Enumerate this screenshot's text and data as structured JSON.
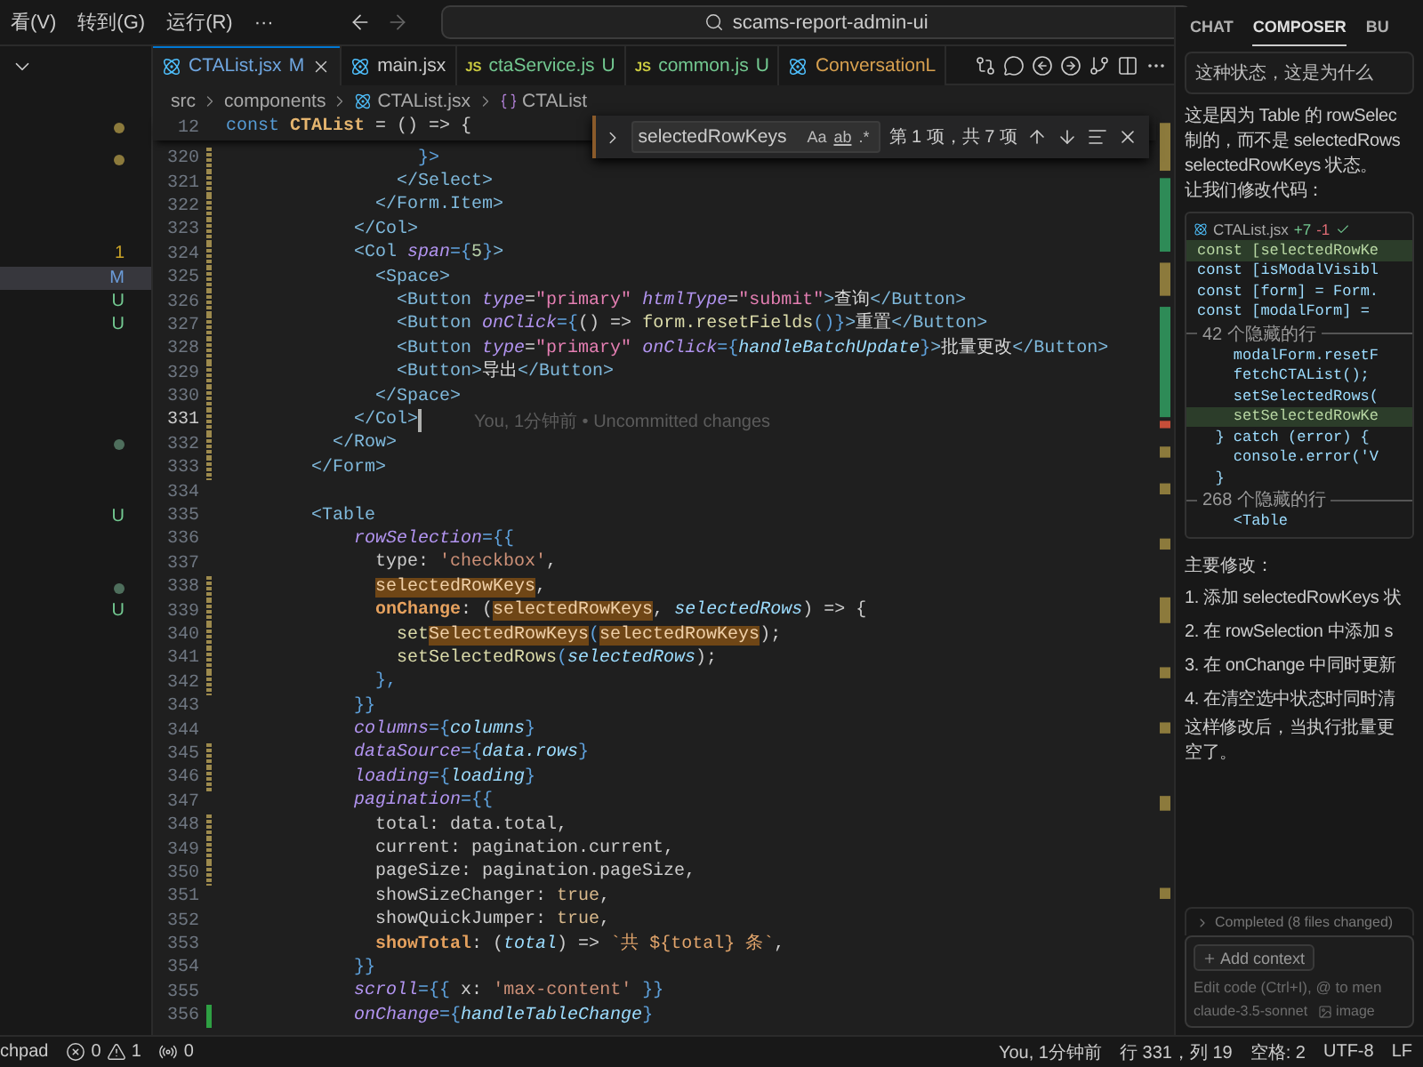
{
  "menu": [
    "看(V)",
    "转到(G)",
    "运行(R)",
    "···"
  ],
  "command_center": {
    "text": "scams-report-admin-ui"
  },
  "tabs": [
    {
      "label": "CTAList.jsx",
      "badge": "M",
      "kind": "react",
      "color": "#6fa6e0",
      "selected": true,
      "close_button": true
    },
    {
      "label": "main.jsx",
      "kind": "react",
      "color": "#cccccc",
      "selected": false,
      "close_button": false
    },
    {
      "label": "ctaService.js",
      "badge": "U",
      "kind": "js",
      "icon_text": "JS",
      "color": "#73c991",
      "selected": false,
      "close_button": false
    },
    {
      "label": "common.js",
      "badge": "U",
      "kind": "js",
      "icon_text": "JS",
      "color": "#73c991",
      "selected": false,
      "close_button": false
    },
    {
      "label": "ConversationL",
      "kind": "react",
      "color": "#d7a04f",
      "selected": false,
      "close_button": false
    }
  ],
  "breadcrumb": [
    {
      "label": "src",
      "kind": "folder"
    },
    {
      "label": "components",
      "kind": "folder"
    },
    {
      "label": "CTAList.jsx",
      "kind": "file"
    },
    {
      "label": "CTAList",
      "kind": "symbol"
    }
  ],
  "find": {
    "query": "selectedRowKeys",
    "options": [
      {
        "label": "Aa",
        "kind": "case"
      },
      {
        "label": "ab",
        "kind": "word"
      },
      {
        "label": ".*",
        "kind": "regex"
      }
    ],
    "result": "第 1 项，共 7 项"
  },
  "explorer": {
    "items": [
      {
        "kind": "dot",
        "color": "#8c7a3c",
        "selected": false
      },
      {
        "kind": "dot",
        "color": "#8c7a3c",
        "selected": false
      },
      {
        "kind": "blank",
        "selected": false
      },
      {
        "kind": "blank",
        "selected": false
      },
      {
        "kind": "blank",
        "selected": false
      },
      {
        "kind": "letter",
        "text": "1",
        "color": "#c9a227",
        "selected": false
      },
      {
        "kind": "letter",
        "text": "M",
        "color": "#6b9bd8",
        "selected": true
      },
      {
        "kind": "letter",
        "text": "U",
        "color": "#73c991",
        "selected": false
      },
      {
        "kind": "letter",
        "text": "U",
        "color": "#73c991",
        "selected": false
      },
      {
        "kind": "blank",
        "selected": false
      },
      {
        "kind": "blank",
        "selected": false
      },
      {
        "kind": "blank",
        "selected": false
      },
      {
        "kind": "blank",
        "selected": false
      },
      {
        "kind": "dot",
        "color": "#4e6e5c",
        "selected": false
      },
      {
        "kind": "blank",
        "selected": false
      },
      {
        "kind": "blank",
        "selected": false
      },
      {
        "kind": "letter",
        "text": "U",
        "color": "#73c991",
        "selected": false
      },
      {
        "kind": "blank",
        "selected": false
      },
      {
        "kind": "blank",
        "selected": false
      },
      {
        "kind": "dot",
        "color": "#4e6e5c",
        "selected": false
      },
      {
        "kind": "letter",
        "text": "U",
        "color": "#73c991",
        "selected": false
      }
    ]
  },
  "code": {
    "sticky": {
      "n": "12",
      "tokens": [
        {
          "text": "const ",
          "kind": "kw"
        },
        {
          "text": "CTAList",
          "kind": "name"
        },
        {
          "text": " = () => {",
          "kind": "p"
        }
      ]
    },
    "lines": [
      {
        "n": "320",
        "current": false,
        "kind": "modified",
        "tokens": [
          {
            "text": "                  }>",
            "kind": "brace"
          }
        ]
      },
      {
        "n": "321",
        "current": false,
        "kind": "modified",
        "tokens": [
          {
            "text": "                </Select>",
            "kind": "tag"
          }
        ]
      },
      {
        "n": "322",
        "current": false,
        "kind": "modified",
        "tokens": [
          {
            "text": "              </Form.Item>",
            "kind": "tag"
          }
        ]
      },
      {
        "n": "323",
        "current": false,
        "kind": "modified",
        "tokens": [
          {
            "text": "            </Col>",
            "kind": "tag"
          }
        ]
      },
      {
        "n": "324",
        "current": false,
        "kind": "modified",
        "tokens": [
          {
            "text": "            <Col ",
            "kind": "tag"
          },
          {
            "text": "span",
            "kind": "attr"
          },
          {
            "text": "={",
            "kind": "brace"
          },
          {
            "text": "5",
            "kind": "num"
          },
          {
            "text": "}",
            "kind": "brace"
          },
          {
            "text": ">",
            "kind": "tag"
          }
        ]
      },
      {
        "n": "325",
        "current": false,
        "kind": "modified",
        "tokens": [
          {
            "text": "              <Space>",
            "kind": "tag"
          }
        ]
      },
      {
        "n": "326",
        "current": false,
        "kind": "modified",
        "tokens": [
          {
            "text": "                <Button ",
            "kind": "tag"
          },
          {
            "text": "type",
            "kind": "attr"
          },
          {
            "text": "=",
            "kind": "p"
          },
          {
            "text": "\"primary\"",
            "kind": "str"
          },
          {
            "text": " htmlType",
            "kind": "attr"
          },
          {
            "text": "=",
            "kind": "p"
          },
          {
            "text": "\"submit\"",
            "kind": "str"
          },
          {
            "text": ">",
            "kind": "tag"
          },
          {
            "text": "查询",
            "kind": "text"
          },
          {
            "text": "</Button>",
            "kind": "tag"
          }
        ]
      },
      {
        "n": "327",
        "current": false,
        "kind": "modified",
        "tokens": [
          {
            "text": "                <Button ",
            "kind": "tag"
          },
          {
            "text": "onClick",
            "kind": "attr"
          },
          {
            "text": "={",
            "kind": "brace"
          },
          {
            "text": "() => ",
            "kind": "p"
          },
          {
            "text": "form.resetFields",
            "kind": "fn"
          },
          {
            "text": "()",
            "kind": "brace"
          },
          {
            "text": "}",
            "kind": "brace"
          },
          {
            "text": ">",
            "kind": "tag"
          },
          {
            "text": "重置",
            "kind": "text"
          },
          {
            "text": "</Button>",
            "kind": "tag"
          }
        ]
      },
      {
        "n": "328",
        "current": false,
        "kind": "modified",
        "tokens": [
          {
            "text": "                <Button ",
            "kind": "tag"
          },
          {
            "text": "type",
            "kind": "attr"
          },
          {
            "text": "=",
            "kind": "p"
          },
          {
            "text": "\"primary\"",
            "kind": "str"
          },
          {
            "text": " onClick",
            "kind": "attr"
          },
          {
            "text": "={",
            "kind": "brace"
          },
          {
            "text": "handleBatchUpdate",
            "kind": "param"
          },
          {
            "text": "}",
            "kind": "brace"
          },
          {
            "text": ">",
            "kind": "tag"
          },
          {
            "text": "批量更改",
            "kind": "text"
          },
          {
            "text": "</Button>",
            "kind": "tag"
          }
        ]
      },
      {
        "n": "329",
        "current": false,
        "kind": "modified",
        "tokens": [
          {
            "text": "                <Button>",
            "kind": "tag"
          },
          {
            "text": "导出",
            "kind": "text"
          },
          {
            "text": "</Button>",
            "kind": "tag"
          }
        ]
      },
      {
        "n": "330",
        "current": false,
        "kind": "modified",
        "tokens": [
          {
            "text": "              </Space>",
            "kind": "tag"
          }
        ]
      },
      {
        "n": "331",
        "current": true,
        "kind": "modified",
        "tokens": [
          {
            "text": "            </Col>",
            "kind": "tag"
          }
        ],
        "annotation": "You, 1分钟前 • Uncommitted changes"
      },
      {
        "n": "332",
        "current": false,
        "kind": "modified",
        "tokens": [
          {
            "text": "          </Row>",
            "kind": "tag"
          }
        ]
      },
      {
        "n": "333",
        "current": false,
        "kind": "modified",
        "tokens": [
          {
            "text": "        </Form>",
            "kind": "tag"
          }
        ]
      },
      {
        "n": "334",
        "current": false,
        "kind": "plain"
      },
      {
        "n": "335",
        "current": false,
        "kind": "plain",
        "tokens": [
          {
            "text": "        <Table",
            "kind": "tag"
          }
        ]
      },
      {
        "n": "336",
        "current": false,
        "kind": "plain",
        "tokens": [
          {
            "text": "            rowSelection",
            "kind": "attr"
          },
          {
            "text": "={{",
            "kind": "brace"
          }
        ]
      },
      {
        "n": "337",
        "current": false,
        "kind": "plain",
        "tokens": [
          {
            "text": "              type",
            "kind": "prop"
          },
          {
            "text": ": ",
            "kind": "p"
          },
          {
            "text": "'checkbox'",
            "kind": "sq"
          },
          {
            "text": ",",
            "kind": "p"
          }
        ]
      },
      {
        "n": "338",
        "current": false,
        "kind": "modified",
        "tokens": [
          {
            "text": "              selectedRowKeys",
            "kind": "match"
          },
          {
            "text": ",",
            "kind": "p"
          }
        ]
      },
      {
        "n": "339",
        "current": false,
        "kind": "modified",
        "tokens": [
          {
            "text": "              onChange",
            "kind": "key"
          },
          {
            "text": ": (",
            "kind": "p"
          },
          {
            "text": "selectedRowKeys",
            "kind": "match"
          },
          {
            "text": ", ",
            "kind": "p"
          },
          {
            "text": "selectedRows",
            "kind": "param"
          },
          {
            "text": ") => {",
            "kind": "p"
          }
        ]
      },
      {
        "n": "340",
        "current": false,
        "kind": "modified",
        "tokens": [
          {
            "text": "                set",
            "kind": "fn"
          },
          {
            "text": "SelectedRowKeys",
            "kind": "match"
          },
          {
            "text": "(",
            "kind": "brace"
          },
          {
            "text": "selectedRowKeys",
            "kind": "match"
          },
          {
            "text": ");",
            "kind": "p"
          }
        ]
      },
      {
        "n": "341",
        "current": false,
        "kind": "modified",
        "tokens": [
          {
            "text": "                setSelectedRows",
            "kind": "fn"
          },
          {
            "text": "(",
            "kind": "brace"
          },
          {
            "text": "selectedRows",
            "kind": "param"
          },
          {
            "text": ");",
            "kind": "p"
          }
        ]
      },
      {
        "n": "342",
        "current": false,
        "kind": "modified",
        "tokens": [
          {
            "text": "              },",
            "kind": "brace"
          }
        ]
      },
      {
        "n": "343",
        "current": false,
        "kind": "plain",
        "tokens": [
          {
            "text": "            }}",
            "kind": "brace"
          }
        ]
      },
      {
        "n": "344",
        "current": false,
        "kind": "plain",
        "tokens": [
          {
            "text": "            columns",
            "kind": "attr"
          },
          {
            "text": "={",
            "kind": "brace"
          },
          {
            "text": "columns",
            "kind": "param"
          },
          {
            "text": "}",
            "kind": "brace"
          }
        ]
      },
      {
        "n": "345",
        "current": false,
        "kind": "modified",
        "tokens": [
          {
            "text": "            dataSource",
            "kind": "attr"
          },
          {
            "text": "={",
            "kind": "brace"
          },
          {
            "text": "data.rows",
            "kind": "param"
          },
          {
            "text": "}",
            "kind": "brace"
          }
        ]
      },
      {
        "n": "346",
        "current": false,
        "kind": "modified",
        "tokens": [
          {
            "text": "            loading",
            "kind": "attr"
          },
          {
            "text": "={",
            "kind": "brace"
          },
          {
            "text": "loading",
            "kind": "param"
          },
          {
            "text": "}",
            "kind": "brace"
          }
        ]
      },
      {
        "n": "347",
        "current": false,
        "kind": "plain",
        "tokens": [
          {
            "text": "            pagination",
            "kind": "attr"
          },
          {
            "text": "={{",
            "kind": "brace"
          }
        ]
      },
      {
        "n": "348",
        "current": false,
        "kind": "modified",
        "tokens": [
          {
            "text": "              total",
            "kind": "prop"
          },
          {
            "text": ": data.total,",
            "kind": "p"
          }
        ]
      },
      {
        "n": "349",
        "current": false,
        "kind": "modified",
        "tokens": [
          {
            "text": "              current",
            "kind": "prop"
          },
          {
            "text": ": pagination.current,",
            "kind": "p"
          }
        ]
      },
      {
        "n": "350",
        "current": false,
        "kind": "modified",
        "tokens": [
          {
            "text": "              pageSize",
            "kind": "prop"
          },
          {
            "text": ": pagination.pageSize,",
            "kind": "p"
          }
        ]
      },
      {
        "n": "351",
        "current": false,
        "kind": "plain",
        "tokens": [
          {
            "text": "              showSizeChanger",
            "kind": "prop"
          },
          {
            "text": ": ",
            "kind": "p"
          },
          {
            "text": "true",
            "kind": "bool"
          },
          {
            "text": ",",
            "kind": "p"
          }
        ]
      },
      {
        "n": "352",
        "current": false,
        "kind": "plain",
        "tokens": [
          {
            "text": "              showQuickJumper",
            "kind": "prop"
          },
          {
            "text": ": ",
            "kind": "p"
          },
          {
            "text": "true",
            "kind": "bool"
          },
          {
            "text": ",",
            "kind": "p"
          }
        ]
      },
      {
        "n": "353",
        "current": false,
        "kind": "plain",
        "tokens": [
          {
            "text": "              showTotal",
            "kind": "key"
          },
          {
            "text": ": (",
            "kind": "p"
          },
          {
            "text": "total",
            "kind": "param"
          },
          {
            "text": ") => ",
            "kind": "p"
          },
          {
            "text": "`共 ${total} 条`",
            "kind": "tpl"
          },
          {
            "text": ",",
            "kind": "p"
          }
        ]
      },
      {
        "n": "354",
        "current": false,
        "kind": "plain",
        "tokens": [
          {
            "text": "            }}",
            "kind": "brace"
          }
        ]
      },
      {
        "n": "355",
        "current": false,
        "kind": "plain",
        "tokens": [
          {
            "text": "            scroll",
            "kind": "attr"
          },
          {
            "text": "={{ ",
            "kind": "brace"
          },
          {
            "text": "x",
            "kind": "prop"
          },
          {
            "text": ": ",
            "kind": "p"
          },
          {
            "text": "'max-content'",
            "kind": "sq"
          },
          {
            "text": " }}",
            "kind": "brace"
          }
        ]
      },
      {
        "n": "356",
        "current": false,
        "kind": "added",
        "tokens": [
          {
            "text": "            onChange",
            "kind": "attr"
          },
          {
            "text": "={",
            "kind": "brace"
          },
          {
            "text": "handleTableChange",
            "kind": "param"
          },
          {
            "text": "}",
            "kind": "brace"
          }
        ]
      }
    ]
  },
  "assistant": {
    "tabs": [
      {
        "label": "CHAT",
        "selected": false
      },
      {
        "label": "COMPOSER",
        "selected": true
      },
      {
        "label": "BU",
        "selected": false
      }
    ],
    "user_message": "这种状态，这是为什么",
    "intro": [
      "这是因为 Table 的 rowSelec",
      "制的，而不是 selectedRows",
      "selectedRowKeys 状态。"
    ],
    "lead": "让我们修改代码：",
    "code_card": {
      "file": "CTAList.jsx",
      "added": "+7",
      "removed": "-1",
      "lines": [
        {
          "kind": "added",
          "text": "const [selectedRowKe"
        },
        {
          "kind": "context",
          "text": "const [isModalVisibl"
        },
        {
          "kind": "context",
          "text": "const [form] = Form."
        },
        {
          "kind": "context",
          "text": "const [modalForm] ="
        },
        {
          "kind": "fold",
          "text": "42 个隐藏的行"
        },
        {
          "kind": "context",
          "text": "    modalForm.resetF"
        },
        {
          "kind": "context",
          "text": "    fetchCTAList();"
        },
        {
          "kind": "context",
          "text": "    setSelectedRows("
        },
        {
          "kind": "added",
          "text": "    setSelectedRowKe"
        },
        {
          "kind": "context",
          "text": "  } catch (error) {"
        },
        {
          "kind": "context",
          "text": "    console.error('V"
        },
        {
          "kind": "context",
          "text": "  }"
        },
        {
          "kind": "fold",
          "text": "268 个隐藏的行"
        },
        {
          "kind": "context",
          "text": "    <Table"
        }
      ]
    },
    "summary_title": "主要修改：",
    "changes": [
      "1. 添加 selectedRowKeys 状",
      "2. 在 rowSelection 中添加 s",
      "3. 在 onChange 中同时更新",
      "4. 在清空选中状态时同时清"
    ],
    "conclusion": [
      "这样修改后，当执行批量更",
      "空了。"
    ],
    "completed": "Completed (8 files changed)",
    "composer": {
      "chip": "Add context",
      "placeholder": "Edit code (Ctrl+I), @ to men",
      "model": "claude-3.5-sonnet",
      "image_button": "image"
    }
  },
  "status_bar": {
    "left": "chpad",
    "errors": "0",
    "warnings": "1",
    "ports": "0",
    "right": [
      "You, 1分钟前",
      "行 331，列 19",
      "空格: 2",
      "UTF-8",
      "LF"
    ]
  }
}
